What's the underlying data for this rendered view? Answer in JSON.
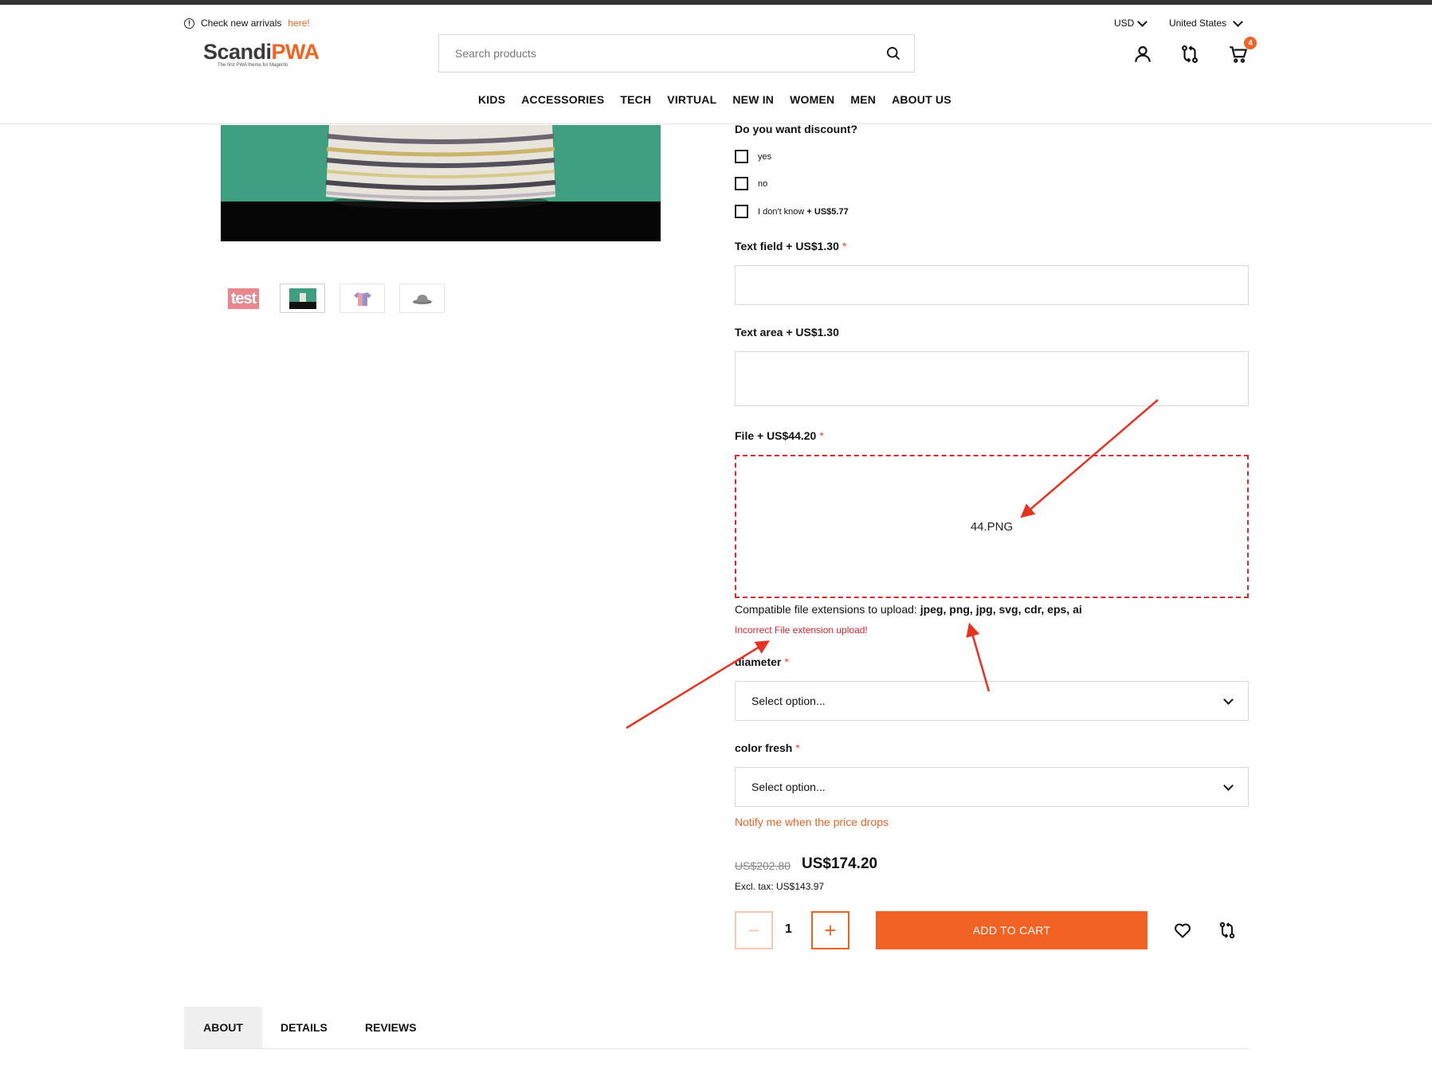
{
  "header": {
    "notice_text": "Check new arrivals",
    "notice_link": "here!",
    "currency": "USD",
    "country": "United States",
    "logo_main": "Scandi",
    "logo_accent": "PWA",
    "logo_tagline": "The first PWA theme for Magento",
    "search_placeholder": "Search products",
    "cart_count": "4"
  },
  "nav": [
    "KIDS",
    "ACCESSORIES",
    "TECH",
    "VIRTUAL",
    "NEW IN",
    "WOMEN",
    "MEN",
    "ABOUT US"
  ],
  "gallery": {
    "thumb_test_label": "test"
  },
  "options": {
    "discount_label": "Do you want discount?",
    "checkbox_yes": "yes",
    "checkbox_no": "no",
    "checkbox_idk": "I don't know",
    "checkbox_idk_price": "+ US$5.77",
    "text_field_label": "Text field + US$1.30",
    "text_area_label": "Text area + US$1.30",
    "file_label": "File + US$44.20",
    "file_name": "44.PNG",
    "compat_text": "Compatible file extensions to upload:",
    "compat_ext": "jpeg, png, jpg, svg, cdr, eps, ai",
    "file_error": "Incorrect File extension upload!",
    "diameter_label": "diameter",
    "diameter_value": "Select option...",
    "color_label": "color fresh",
    "color_value": "Select option...",
    "required_mark": "*"
  },
  "pricing": {
    "notify": "Notify me when the price drops",
    "old_price": "US$202.80",
    "price": "US$174.20",
    "excl_tax": "Excl. tax: US$143.97"
  },
  "cart": {
    "minus": "−",
    "plus": "+",
    "quantity": "1",
    "add_to_cart": "ADD TO CART"
  },
  "tabs": [
    "ABOUT",
    "DETAILS",
    "REVIEWS"
  ],
  "colors": {
    "accent": "#f26323",
    "error": "#e0262d",
    "annotation": "#e8321f"
  }
}
